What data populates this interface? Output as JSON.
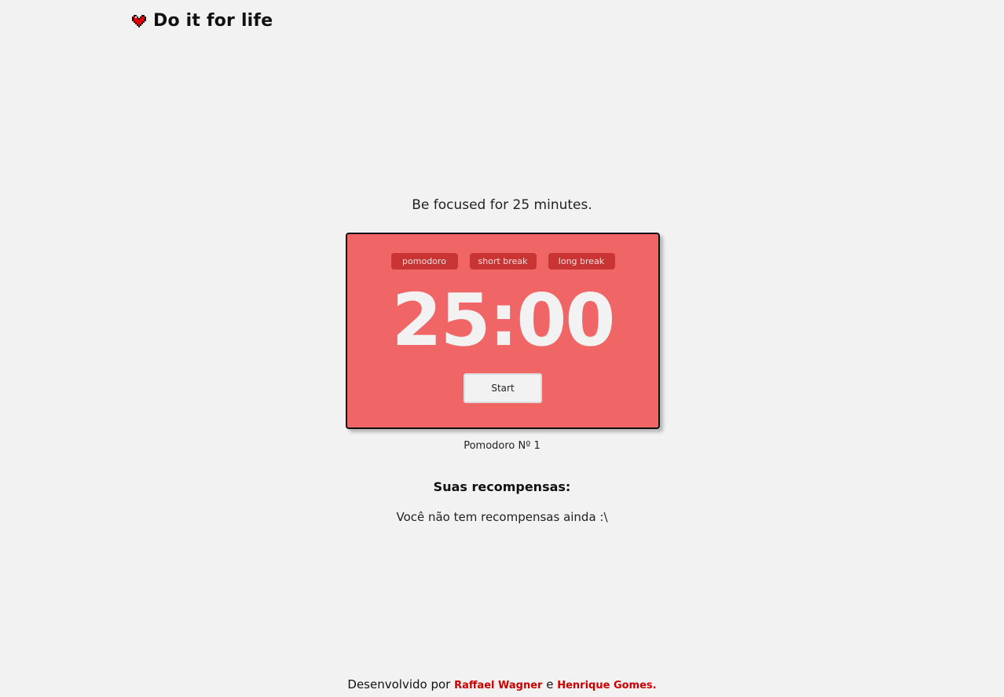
{
  "header": {
    "title": "Do it for life",
    "icon": "pixel-heart-icon",
    "icon_color": "#e00000"
  },
  "focus_text": "Be focused for 25 minutes.",
  "timer": {
    "tabs": [
      {
        "label": "pomodoro"
      },
      {
        "label": "short break"
      },
      {
        "label": "long break"
      }
    ],
    "display": "25:00",
    "start_label": "Start",
    "card_color": "#f06565",
    "tab_color": "#c93434"
  },
  "pomodoro_count": "Pomodoro Nº 1",
  "rewards": {
    "title": "Suas recompensas:",
    "empty_message": "Você não tem recompensas ainda :\\"
  },
  "footer": {
    "prefix": "Desenvolvido por",
    "author1": "Raffael Wagner",
    "connector": "e",
    "author2": "Henrique Gomes."
  }
}
